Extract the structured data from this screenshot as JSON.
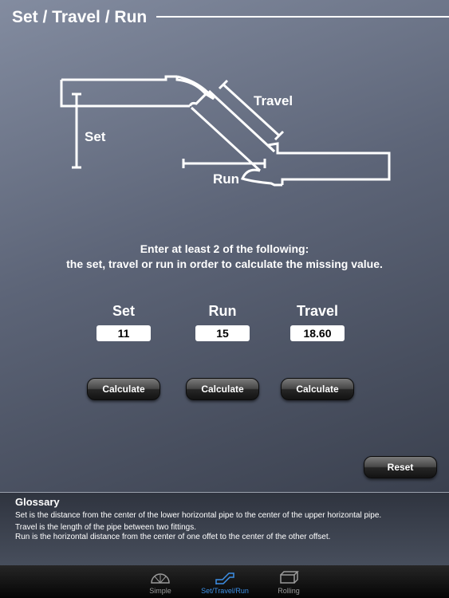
{
  "header": {
    "title": "Set / Travel / Run"
  },
  "diagram": {
    "labels": {
      "travel": "Travel",
      "set": "Set",
      "run": "Run"
    }
  },
  "instructions": {
    "line1": "Enter at least 2 of the following:",
    "line2": "the set, travel or run in order to calculate the missing value."
  },
  "fields": {
    "set": {
      "label": "Set",
      "value": "11"
    },
    "run": {
      "label": "Run",
      "value": "15"
    },
    "travel": {
      "label": "Travel",
      "value": "18.60"
    }
  },
  "buttons": {
    "calculate": "Calculate",
    "reset": "Reset"
  },
  "glossary": {
    "title": "Glossary",
    "set": "Set is the distance from the center of the lower horizontal pipe to the center of the upper horizontal pipe.",
    "travel": "Travel is the length of the pipe between two fittings.",
    "run": "Run is the horizontal distance from the center of one offet to the center of the other offset."
  },
  "tabbar": {
    "tabs": [
      {
        "label": "Simple",
        "icon": "protractor-icon",
        "active": false
      },
      {
        "label": "Set/Travel/Run",
        "icon": "offset-pipe-icon",
        "active": true
      },
      {
        "label": "Rolling",
        "icon": "rolling-box-icon",
        "active": false
      }
    ]
  },
  "colors": {
    "active_tab": "#3d8fe6",
    "inactive_tab": "#9a9a9a",
    "diagram_stroke": "#ffffff"
  }
}
